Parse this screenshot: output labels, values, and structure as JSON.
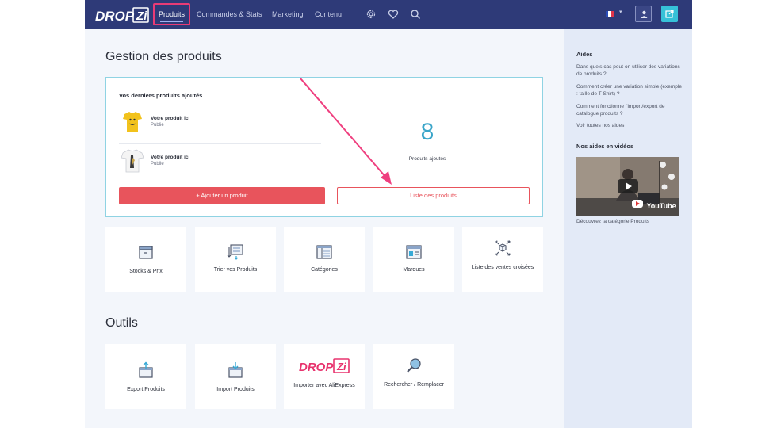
{
  "nav": {
    "logo_text": "DROP|Zi",
    "active": "Produits",
    "items": [
      "Commandes & Stats",
      "Marketing",
      "Contenu"
    ]
  },
  "page": {
    "title": "Gestion des produits",
    "recent": {
      "label": "Vos derniers produits ajoutés",
      "products": [
        {
          "name": "Votre produit ici",
          "status": "Publié"
        },
        {
          "name": "Votre produit ici",
          "status": "Publié"
        }
      ],
      "count": "8",
      "count_label": "Produits ajoutés",
      "add_button": "+ Ajouter un produit",
      "list_button": "Liste des produits"
    },
    "product_tiles": [
      {
        "label": "Stocks & Prix",
        "icon": "box-icon"
      },
      {
        "label": "Trier vos Produits",
        "icon": "sort-icon"
      },
      {
        "label": "Catégories",
        "icon": "categories-icon"
      },
      {
        "label": "Marques",
        "icon": "brands-icon"
      },
      {
        "label": "Liste des ventes croisées",
        "icon": "cross-sell-icon"
      }
    ],
    "tools_title": "Outils",
    "tool_tiles": [
      {
        "label": "Export Produits",
        "icon": "export-icon"
      },
      {
        "label": "Import Produits",
        "icon": "import-icon"
      },
      {
        "label": "Importer avec AliExpress",
        "icon": "dropizi-logo"
      },
      {
        "label": "Rechercher / Remplacer",
        "icon": "search-replace-icon"
      }
    ]
  },
  "aside": {
    "help_title": "Aides",
    "links": [
      "Dans quels cas peut-on utiliser des variations de produits ?",
      "Comment créer une variation simple (exemple : taille de T-Shirt) ?",
      "Comment fonctionne l'import/export de catalogue produits ?",
      "Voir toutes nos aides"
    ],
    "video_title": "Nos aides en vidéos",
    "video_brand": "YouTube",
    "video_caption": "Découvrez la catégorie Produits"
  },
  "colors": {
    "nav": "#2e3a78",
    "accent": "#e8545c",
    "highlight": "#e83b76",
    "count": "#3aa5c9",
    "cyan": "#36c1d8"
  }
}
